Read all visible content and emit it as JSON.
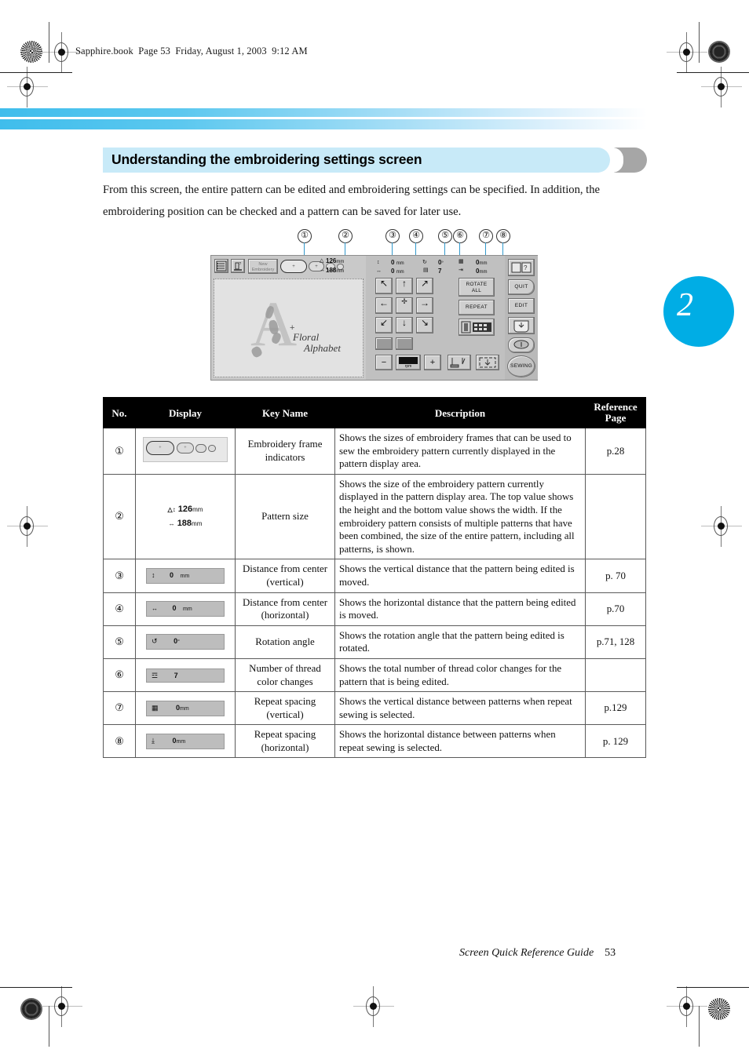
{
  "page": {
    "book_header": "Sapphire.book  Page 53  Friday, August 1, 2003  9:12 AM",
    "chapter_number": "2",
    "footer_text": "Screen Quick Reference Guide",
    "footer_page": "53",
    "accent_color": "#00ade5",
    "title_band_color": "#c8eaf8"
  },
  "section": {
    "title": "Understanding the embroidering settings screen",
    "intro_line1": "From this screen, the entire pattern can be edited and embroidering settings can be specified. In addition, the",
    "intro_line2": "embroidering position can be checked and a pattern can be saved for later use."
  },
  "callouts": [
    "①",
    "②",
    "③",
    "④",
    "⑤",
    "⑥",
    "⑦",
    "⑧"
  ],
  "lcd": {
    "new_embroidery_label": "New\nEmbroidery",
    "pattern_size_height": "126",
    "pattern_size_width": "188",
    "unit_mm": "mm",
    "vertical_distance": "0",
    "horizontal_distance": "0",
    "rotation_angle": "0",
    "rotation_unit": "°",
    "thread_color_changes": "7",
    "repeat_spacing_vertical": "0",
    "repeat_spacing_horizontal": "0",
    "pattern_letter": "A",
    "pattern_text_line1": "Floral",
    "pattern_text_line2": "Alphabet",
    "center_mark": "+",
    "buttons": {
      "rotate_all": "ROTATE\nALL",
      "repeat": "REPEAT",
      "speed_unit": "rpm",
      "minus": "−",
      "plus": "+"
    },
    "side_buttons": {
      "quit": "QUIT",
      "edit": "EDIT",
      "sewing": "SEWING"
    }
  },
  "table": {
    "headers": {
      "no": "No.",
      "display": "Display",
      "key_name": "Key Name",
      "description": "Description",
      "reference_page": "Reference\nPage"
    },
    "rows": [
      {
        "no": "①",
        "display_kind": "frame-indicators",
        "display_value": "",
        "key_name": "Embroidery frame indicators",
        "description": "Shows the sizes of embroidery frames that can be used to sew the embroidery pattern currently displayed in the pattern display area.",
        "reference_page": "p.28"
      },
      {
        "no": "②",
        "display_kind": "pattern-size",
        "display_value": "126mm / 188mm",
        "key_name": "Pattern size",
        "description": "Shows the size of the embroidery pattern currently displayed in the pattern display area. The top value shows the height and the bottom value shows the width. If the embroidery pattern consists of multiple patterns that have been combined, the size of the entire pattern, including all patterns, is shown.",
        "reference_page": ""
      },
      {
        "no": "③",
        "display_kind": "value-box",
        "display_icon": "↕",
        "display_value": "0",
        "display_unit": "mm",
        "key_name": "Distance from center (vertical)",
        "description": "Shows the vertical distance that the pattern being edited is moved.",
        "reference_page": "p. 70"
      },
      {
        "no": "④",
        "display_kind": "value-box",
        "display_icon": "↔",
        "display_value": "0",
        "display_unit": "mm",
        "key_name": "Distance from center (horizontal)",
        "description": "Shows the horizontal distance that the pattern being edited is moved.",
        "reference_page": "p.70"
      },
      {
        "no": "⑤",
        "display_kind": "value-box",
        "display_icon": "↺",
        "display_value": "0",
        "display_unit": "°",
        "key_name": "Rotation angle",
        "description": "Shows the rotation angle that the pattern being edited is rotated.",
        "reference_page": "p.71, 128"
      },
      {
        "no": "⑥",
        "display_kind": "value-box",
        "display_icon": "☲",
        "display_value": "7",
        "display_unit": "",
        "key_name": "Number of thread color changes",
        "description": "Shows the total number of thread color changes for the pattern that is being edited.",
        "reference_page": ""
      },
      {
        "no": "⑦",
        "display_kind": "value-box",
        "display_icon": "▦",
        "display_value": "0",
        "display_unit": "mm",
        "key_name": "Repeat spacing (vertical)",
        "description": "Shows the vertical distance between patterns when repeat sewing is selected.",
        "reference_page": "p.129"
      },
      {
        "no": "⑧",
        "display_kind": "value-box",
        "display_icon": "⤓",
        "display_value": "0",
        "display_unit": "mm",
        "key_name": "Repeat spacing (horizontal)",
        "description": "Shows the horizontal distance between patterns when repeat sewing is selected.",
        "reference_page": "p. 129"
      }
    ]
  }
}
